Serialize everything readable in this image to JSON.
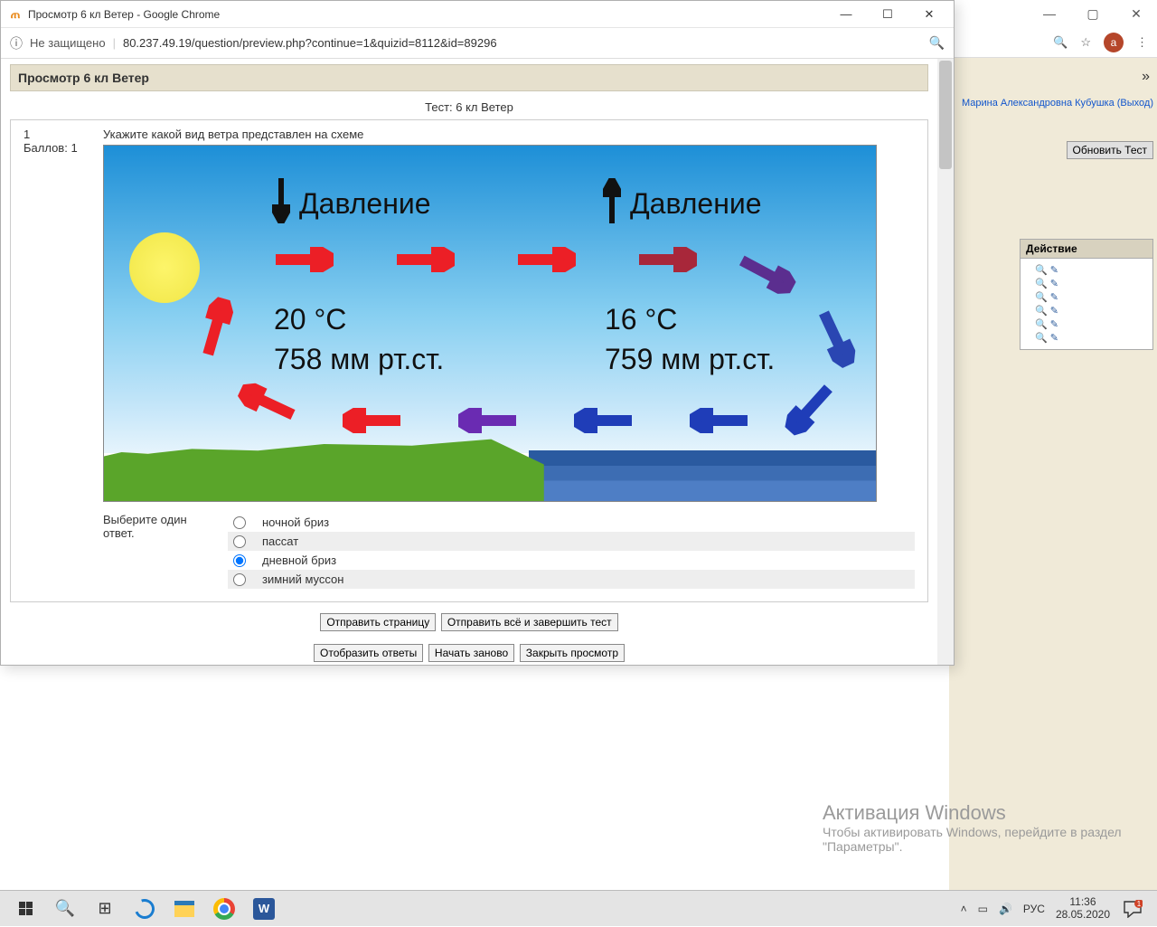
{
  "bg": {
    "avatar_letter": "a",
    "overflow": "»",
    "user_link": "Марина Александровна Кубушка (Выход)",
    "refresh_btn": "Обновить Тест",
    "block_header": "Действие"
  },
  "fg": {
    "title": "Просмотр 6 кл Ветер - Google Chrome",
    "not_secure": "Не защищено",
    "url": "80.237.49.19/question/preview.php?continue=1&quizid=8112&id=89296",
    "quiz_header": "Просмотр 6 кл Ветер",
    "test_title": "Тест: 6 кл Ветер",
    "q_number": "1",
    "q_score": "Баллов: 1",
    "q_text": "Укажите какой вид ветра представлен на схеме",
    "diagram": {
      "label_left": "Давление",
      "label_right": "Давление",
      "temp_left": "20 °C",
      "press_left": "758 мм рт.ст.",
      "temp_right": "16 °C",
      "press_right": "759 мм рт.ст."
    },
    "answer_prompt": "Выберите один ответ.",
    "answers": {
      "a": "ночной бриз",
      "b": "пассат",
      "c": "дневной бриз",
      "d": "зимний муссон"
    },
    "btn_submit_page": "Отправить страницу",
    "btn_submit_all": "Отправить всё и завершить тест",
    "btn_show_answers": "Отобразить ответы",
    "btn_restart": "Начать заново",
    "btn_close": "Закрыть просмотр"
  },
  "watermark": {
    "line1": "Активация Windows",
    "line2": "Чтобы активировать Windows, перейдите в раздел \"Параметры\"."
  },
  "taskbar": {
    "lang": "РУС",
    "time": "11:36",
    "date": "28.05.2020",
    "word_letter": "W",
    "notif_badge": "1"
  }
}
